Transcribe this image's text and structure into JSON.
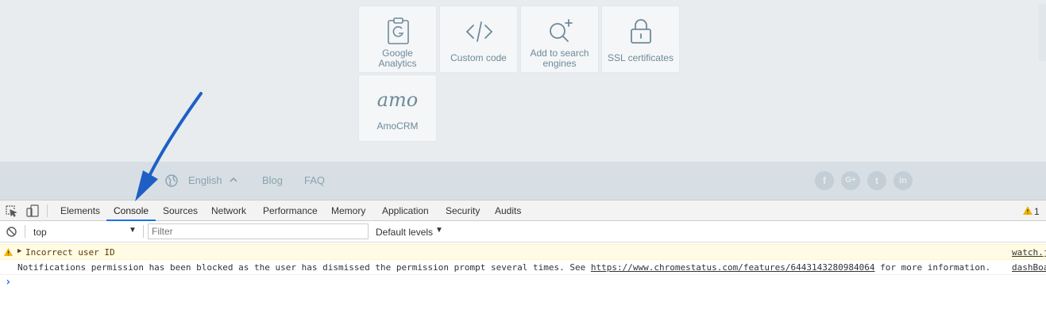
{
  "integrations": [
    {
      "label": "Google Analytics",
      "icon": "google-analytics-icon"
    },
    {
      "label": "Custom code",
      "icon": "code-icon"
    },
    {
      "label": "Add to search engines",
      "icon": "search-add-icon"
    },
    {
      "label": "SSL certificates",
      "icon": "lock-icon"
    },
    {
      "label": "AmoCRM",
      "icon": "amocrm-logo"
    }
  ],
  "amo_logo_text": "amo",
  "footer": {
    "language": "English",
    "blog": "Blog",
    "faq": "FAQ",
    "social": [
      {
        "glyph": "f",
        "icon": "facebook-icon"
      },
      {
        "glyph": "G+",
        "icon": "google-plus-icon"
      },
      {
        "glyph": "t",
        "icon": "twitter-icon"
      },
      {
        "glyph": "in",
        "icon": "linkedin-icon"
      }
    ]
  },
  "devtools": {
    "tabs": [
      "Elements",
      "Console",
      "Sources",
      "Network",
      "Performance",
      "Memory",
      "Application",
      "Security",
      "Audits"
    ],
    "active_tab": "Console",
    "warning_count": "1",
    "context": "top",
    "filter_placeholder": "Filter",
    "levels": "Default levels",
    "messages": {
      "warning_text": "Incorrect user ID",
      "warning_source": "watch.js",
      "info_text_before": "Notifications permission has been blocked as the user has dismissed the permission prompt several times. See ",
      "info_link": "https://www.chromestatus.com/features/6443143280984064",
      "info_text_after": " for more information.",
      "info_source": "dashBoard"
    },
    "prompt": "›"
  },
  "colors": {
    "accent": "#1a73e8",
    "arrow": "#1f5fc5",
    "warning": "#f2b400"
  }
}
